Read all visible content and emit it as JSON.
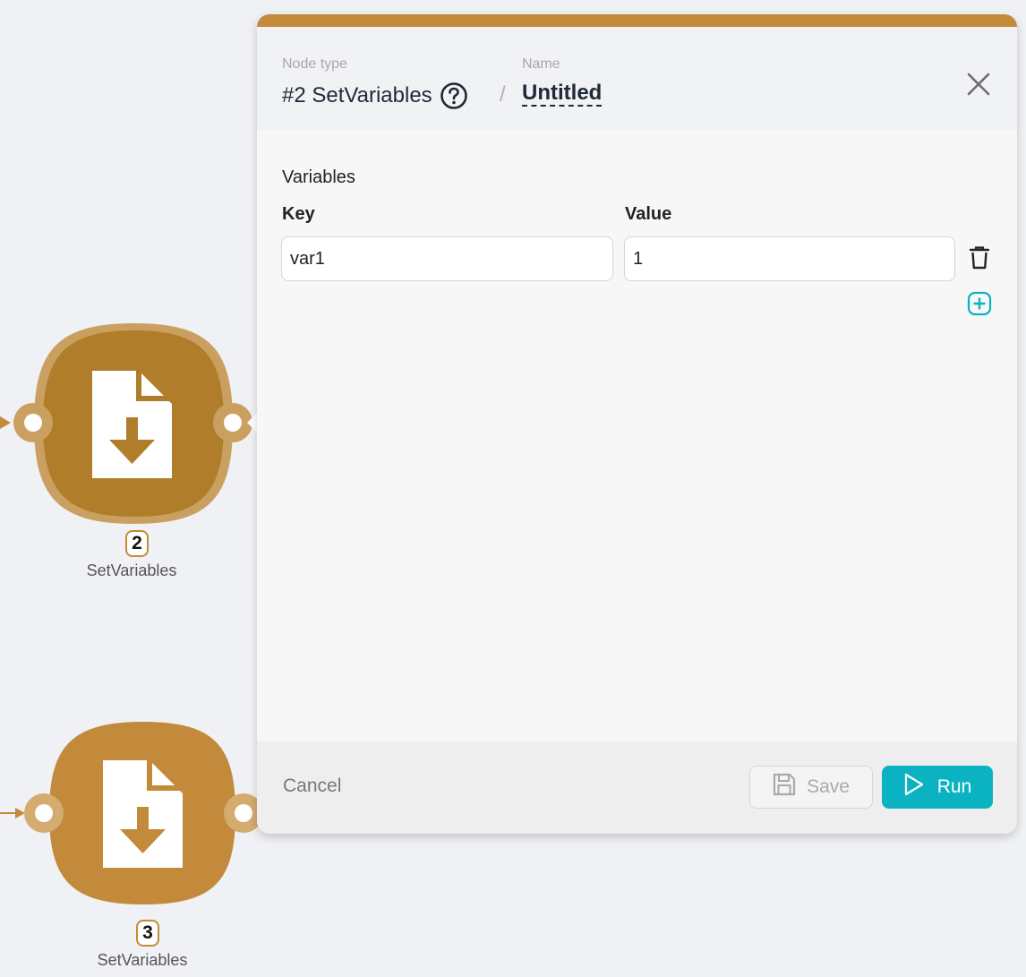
{
  "colors": {
    "accent": "#c28a3a",
    "node_selected": "#b07d2a",
    "primary_button": "#0bb3c2",
    "canvas_bg": "#f0f1f4"
  },
  "nodes": [
    {
      "number": "2",
      "label": "SetVariables",
      "icon": "file-download-icon",
      "selected": true
    },
    {
      "number": "3",
      "label": "SetVariables",
      "icon": "file-download-icon",
      "selected": false
    }
  ],
  "dialog": {
    "node_type_caption": "Node type",
    "node_type_value": "#2 SetVariables",
    "name_caption": "Name",
    "separator": "/",
    "name_value": "Untitled",
    "help_icon": "help-circle-icon",
    "close_icon": "close-icon",
    "section_title": "Variables",
    "key_header": "Key",
    "value_header": "Value",
    "rows": [
      {
        "key": "var1",
        "value": "1"
      }
    ],
    "delete_icon": "trash-icon",
    "add_icon": "plus-square-icon",
    "cancel_label": "Cancel",
    "save_label": "Save",
    "save_icon": "save-icon",
    "run_label": "Run",
    "run_icon": "play-icon"
  }
}
